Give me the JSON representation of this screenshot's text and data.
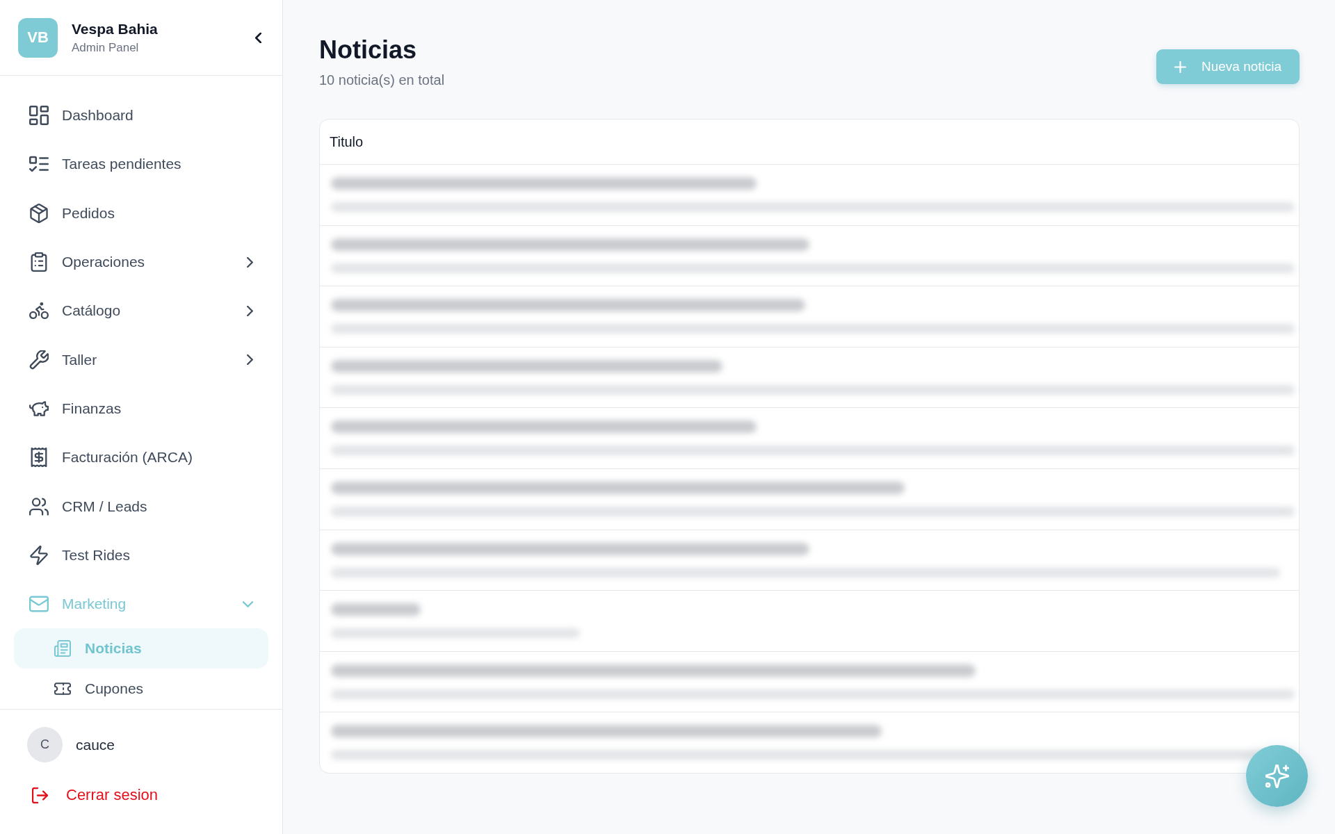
{
  "sidebar": {
    "brand": {
      "initials": "VB",
      "name": "Vespa Bahia",
      "subtitle": "Admin Panel"
    },
    "items": [
      {
        "kind": "link",
        "label": "Dashboard",
        "selected": false
      },
      {
        "kind": "link",
        "label": "Tareas pendientes",
        "selected": false
      },
      {
        "kind": "link",
        "label": "Pedidos",
        "selected": false
      },
      {
        "kind": "group",
        "label": "Operaciones",
        "expanded": false
      },
      {
        "kind": "group",
        "label": "Catálogo",
        "expanded": false
      },
      {
        "kind": "group",
        "label": "Taller",
        "expanded": false
      },
      {
        "kind": "link",
        "label": "Finanzas",
        "selected": false
      },
      {
        "kind": "link",
        "label": "Facturación (ARCA)",
        "selected": false
      },
      {
        "kind": "link",
        "label": "CRM / Leads",
        "selected": false
      },
      {
        "kind": "link",
        "label": "Test Rides",
        "selected": false
      },
      {
        "kind": "group",
        "label": "Marketing",
        "expanded": true,
        "children": [
          {
            "label": "Noticias",
            "selected": true
          },
          {
            "label": "Cupones",
            "selected": false
          }
        ]
      }
    ],
    "user": {
      "initial": "C",
      "name": "cauce"
    },
    "logout": {
      "label": "Cerrar sesion"
    }
  },
  "page": {
    "title": "Noticias",
    "subtitle": "10 noticia(s) en total",
    "new_button": {
      "label": "Nueva noticia"
    }
  },
  "table": {
    "columns": [
      "Titulo"
    ],
    "rows": [
      {
        "kind": "blurred"
      },
      {
        "kind": "blurred"
      },
      {
        "kind": "blurred"
      },
      {
        "kind": "blurred"
      },
      {
        "kind": "blurred"
      },
      {
        "kind": "blurred"
      },
      {
        "kind": "blurred"
      },
      {
        "kind": "blurred"
      },
      {
        "kind": "blurred"
      },
      {
        "kind": "blurred"
      }
    ]
  }
}
